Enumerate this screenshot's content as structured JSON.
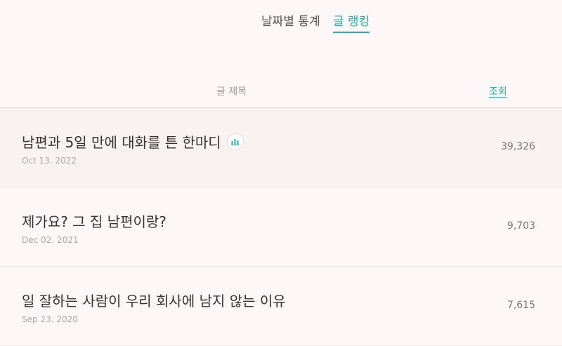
{
  "tabs": [
    {
      "label": "날짜별 통계",
      "active": false
    },
    {
      "label": "글 랭킹",
      "active": true
    }
  ],
  "table": {
    "header_title": "글 제목",
    "header_views": "조회"
  },
  "rows": [
    {
      "title": "남편과 5일 만에 대화를 튼 한마디",
      "date": "Oct 13. 2022",
      "views": "39,326",
      "icon": "stats-chart-icon"
    },
    {
      "title": "제가요? 그 집 남편이랑?",
      "date": "Dec 02. 2021",
      "views": "9,703"
    },
    {
      "title": "일 잘하는 사람이 우리 회사에 남지 않는 이유",
      "date": "Sep 23. 2020",
      "views": "7,615"
    }
  ],
  "colors": {
    "accent": "#29b0a3",
    "background": "#fdf8f7",
    "highlight_row": "#f8f2f1"
  }
}
